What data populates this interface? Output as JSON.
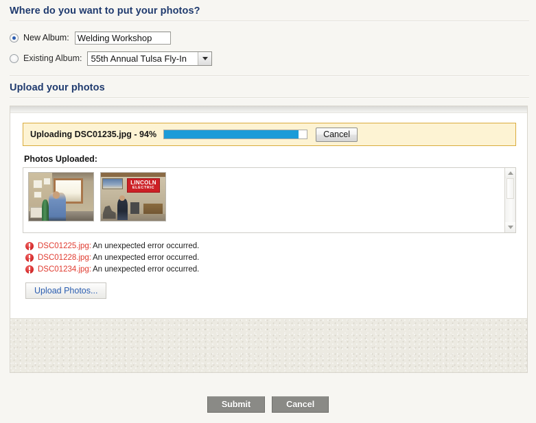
{
  "album_section": {
    "heading": "Where do you want to put your photos?",
    "new_album": {
      "label": "New Album:",
      "value": "Welding Workshop",
      "placeholder": "",
      "selected": true
    },
    "existing_album": {
      "label": "Existing Album:",
      "value": "55th Annual Tulsa Fly-In",
      "selected": false,
      "arrow_icon": "chevron-down-icon"
    }
  },
  "upload_section": {
    "heading": "Upload your photos",
    "status": {
      "text": "Uploading DSC01235.jpg - 94%",
      "percent": 94,
      "progress_color": "#1b9bd8",
      "cancel_label": "Cancel"
    },
    "photos_uploaded_label": "Photos Uploaded:",
    "thumbnails": [
      {
        "alt": "Workshop interior with person near window and green gas cylinder"
      },
      {
        "alt": "Shop interior with red LINCOLN ELECTRIC banner and person",
        "banner_line1": "LINCOLN",
        "banner_line2": "ELECTRIC"
      }
    ],
    "scrollbar": {
      "up_icon": "scroll-up-arrow-icon",
      "down_icon": "scroll-down-arrow-icon"
    },
    "errors": [
      {
        "icon": "error-icon",
        "file": "DSC01225.jpg:",
        "message": "An unexpected error occurred."
      },
      {
        "icon": "error-icon",
        "file": "DSC01228.jpg:",
        "message": "An unexpected error occurred."
      },
      {
        "icon": "error-icon",
        "file": "DSC01234.jpg:",
        "message": "An unexpected error occurred."
      }
    ],
    "upload_button_label": "Upload Photos..."
  },
  "footer": {
    "submit_label": "Submit",
    "cancel_label": "Cancel"
  },
  "colors": {
    "heading": "#1f3a6e",
    "error_text": "#e03a2f",
    "progress": "#1b9bd8",
    "banner_bg": "#fdf3d3",
    "banner_border": "#d9ab3c"
  }
}
